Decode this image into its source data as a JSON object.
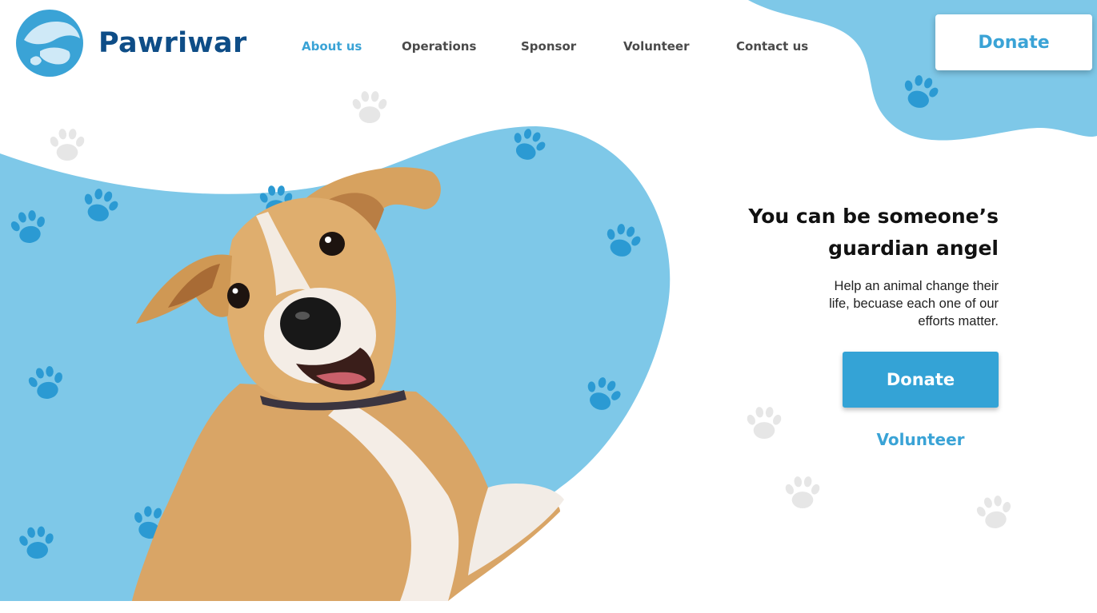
{
  "brand": {
    "name": "Pawriwar",
    "logo_icon": "animals-silhouette-logo-icon"
  },
  "nav": {
    "items": [
      {
        "label": "About us",
        "active": true
      },
      {
        "label": "Operations",
        "active": false
      },
      {
        "label": "Sponsor",
        "active": false
      },
      {
        "label": "Volunteer",
        "active": false
      },
      {
        "label": "Contact us",
        "active": false
      }
    ]
  },
  "header": {
    "donate_label": "Donate"
  },
  "hero": {
    "headline_line1": "You can be someone’s",
    "headline_line2": "guardian angel",
    "subtext_line1": "Help an animal change their",
    "subtext_line2": "life, becuase each one of our",
    "subtext_line3": "efforts matter.",
    "donate_label": "Donate",
    "volunteer_label": "Volunteer",
    "image_icon": "dog-photo-icon"
  },
  "colors": {
    "accent": "#3aa3d6",
    "blob": "#7ec8e8",
    "paw_blue": "#2b9ad3",
    "paw_gray": "#e6e6e6",
    "brand_text": "#0e4d87"
  }
}
